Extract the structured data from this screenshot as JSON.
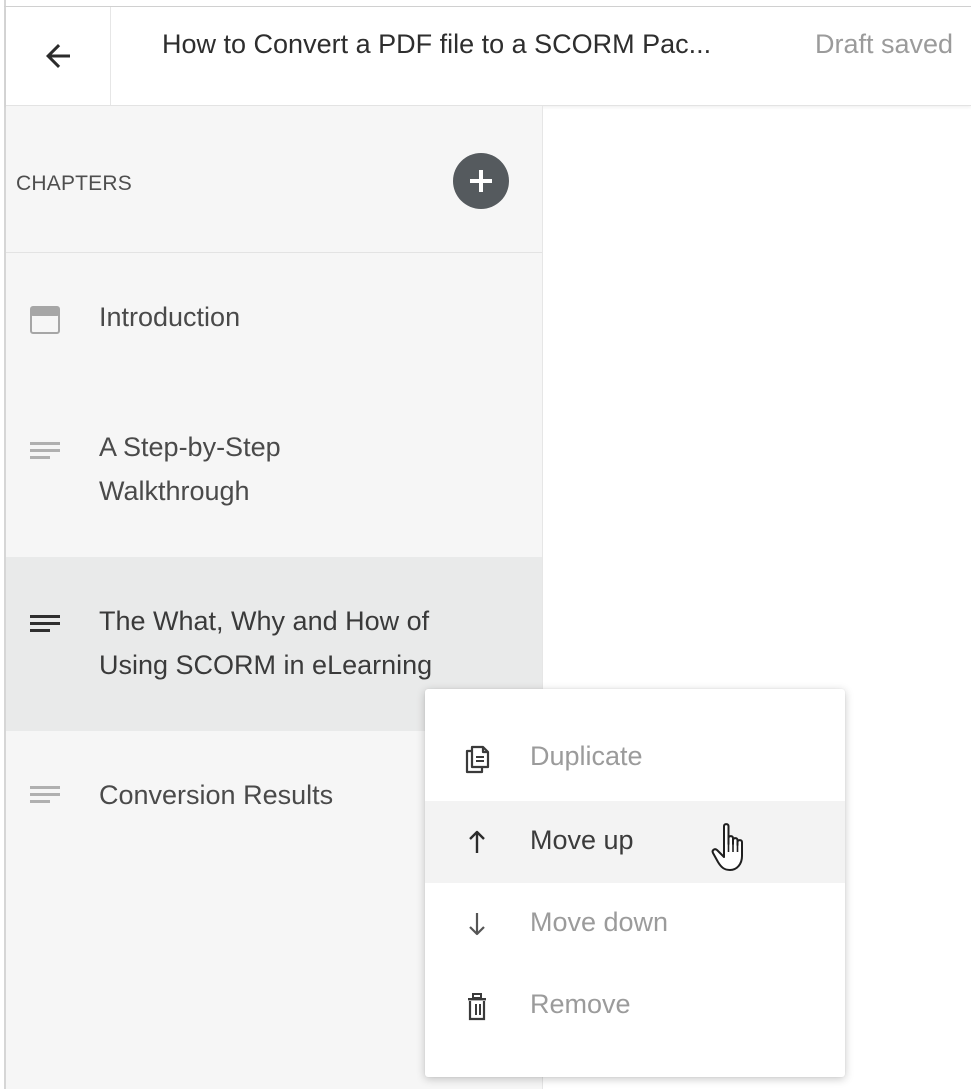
{
  "header": {
    "back_icon": "arrow-left-icon",
    "title": "How to Convert a PDF file to a SCORM Pac...",
    "status": "Draft saved"
  },
  "sidebar": {
    "section_label": "CHAPTERS",
    "add_icon": "plus-circle-icon",
    "chapters": [
      {
        "label_lines": [
          "Introduction"
        ],
        "icon": "page-header-icon",
        "selected": false
      },
      {
        "label_lines": [
          "A Step-by-Step",
          "Walkthrough"
        ],
        "icon": "text-lines-icon",
        "selected": false
      },
      {
        "label_lines": [
          "The What, Why and How of",
          "Using SCORM in eLearning"
        ],
        "icon": "text-lines-icon",
        "selected": true
      },
      {
        "label_lines": [
          "Conversion Results"
        ],
        "icon": "text-lines-icon",
        "selected": false
      }
    ]
  },
  "context_menu": {
    "items": [
      {
        "label": "Duplicate",
        "icon": "duplicate-icon"
      },
      {
        "label": "Move up",
        "icon": "arrow-up-icon",
        "hovered": true
      },
      {
        "label": "Move down",
        "icon": "arrow-down-icon"
      },
      {
        "label": "Remove",
        "icon": "trash-icon"
      }
    ]
  },
  "colors": {
    "sidebar_bg": "#f6f6f6",
    "selected_bg": "#e9eaea",
    "add_button_bg": "#555a5e",
    "muted_text": "#9b9b9b",
    "primary_text": "#2e2e2e"
  }
}
